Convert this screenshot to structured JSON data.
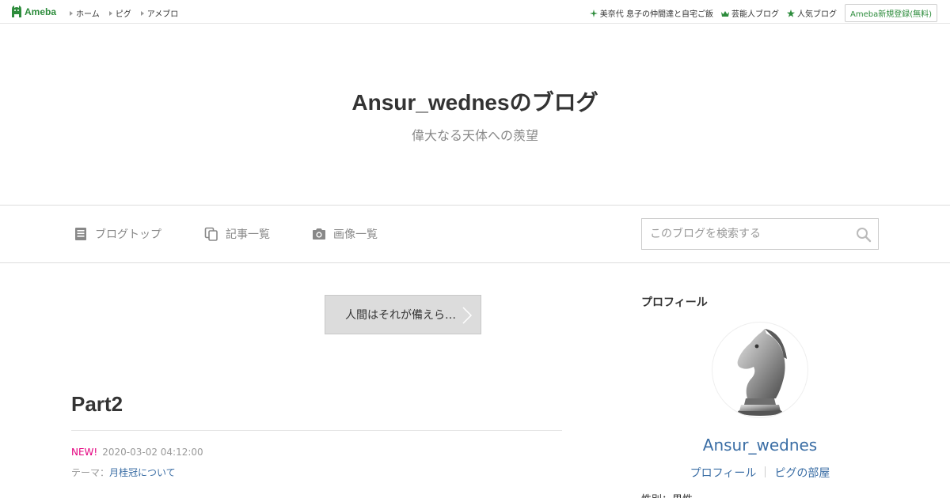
{
  "topbar": {
    "logo_text": "Ameba",
    "nav": [
      {
        "label": "ホーム"
      },
      {
        "label": "ピグ"
      },
      {
        "label": "アメブロ"
      }
    ],
    "right_links": [
      {
        "label": "美奈代 息子の仲間達と自宅ご飯",
        "icon": "sparkle-icon"
      },
      {
        "label": "芸能人ブログ",
        "icon": "crown-icon"
      },
      {
        "label": "人気ブログ",
        "icon": "star-icon"
      }
    ],
    "signup_label": "Ameba新規登録(無料)"
  },
  "header": {
    "title": "Ansur_wednesのブログ",
    "subtitle": "偉大なる天体への羨望"
  },
  "nav": {
    "items": [
      {
        "label": "ブログトップ",
        "icon": "document-icon"
      },
      {
        "label": "記事一覧",
        "icon": "copy-icon"
      },
      {
        "label": "画像一覧",
        "icon": "camera-icon"
      }
    ],
    "search_placeholder": "このブログを検索する"
  },
  "main": {
    "prev_entry_label": "人間はそれが備えら…",
    "entry": {
      "title": "Part2",
      "new_badge": "NEW!",
      "datetime": "2020-03-02 04:12:00",
      "theme_prefix": "テーマ：",
      "theme_link": "月桂冠について"
    }
  },
  "sidebar": {
    "heading": "プロフィール",
    "name": "Ansur_wednes",
    "links": [
      {
        "label": "プロフィール"
      },
      {
        "label": "ピグの部屋"
      }
    ],
    "cut_text": "性別：男性"
  },
  "colors": {
    "ameba_green": "#2d8c3c",
    "link_blue": "#3b6ea5",
    "new_pink": "#e4007f"
  }
}
